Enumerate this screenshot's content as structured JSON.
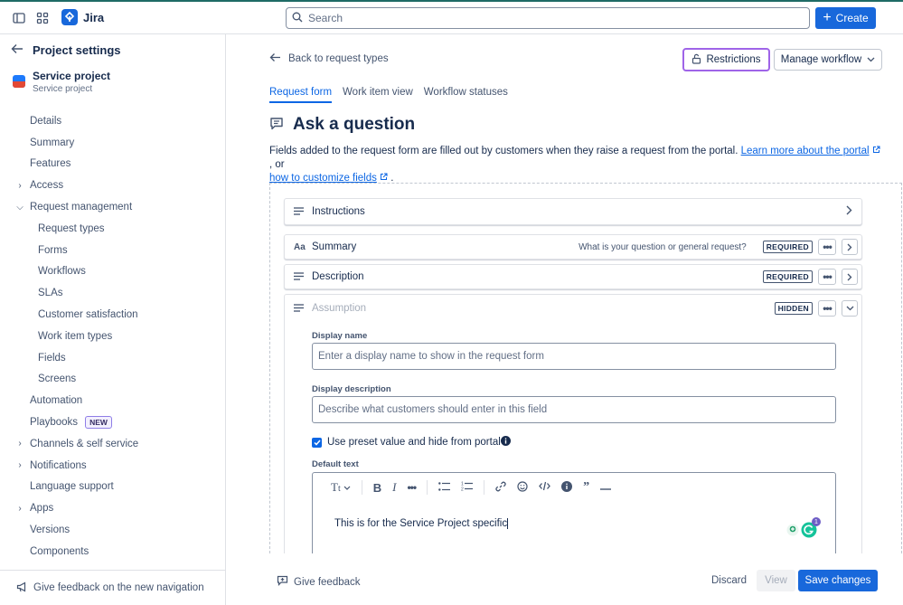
{
  "topbar": {
    "app_name": "Jira",
    "search_placeholder": "Search",
    "create_label": "Create"
  },
  "sidebar": {
    "title": "Project settings",
    "project_name": "Service project",
    "project_type": "Service project",
    "items": [
      {
        "label": "Details"
      },
      {
        "label": "Summary"
      },
      {
        "label": "Features"
      },
      {
        "label": "Access"
      },
      {
        "label": "Request management"
      },
      {
        "label": "Request types"
      },
      {
        "label": "Forms"
      },
      {
        "label": "Workflows"
      },
      {
        "label": "SLAs"
      },
      {
        "label": "Customer satisfaction"
      },
      {
        "label": "Work item types"
      },
      {
        "label": "Fields"
      },
      {
        "label": "Screens"
      },
      {
        "label": "Automation"
      },
      {
        "label": "Playbooks",
        "badge": "NEW"
      },
      {
        "label": "Channels & self service"
      },
      {
        "label": "Notifications"
      },
      {
        "label": "Language support"
      },
      {
        "label": "Apps"
      },
      {
        "label": "Versions"
      },
      {
        "label": "Components"
      }
    ],
    "feedback_label": "Give feedback on the new navigation"
  },
  "main": {
    "back_label": "Back to request types",
    "restrictions_label": "Restrictions",
    "manage_workflow_label": "Manage workflow",
    "tabs": [
      {
        "label": "Request form",
        "active": true
      },
      {
        "label": "Work item view",
        "active": false
      },
      {
        "label": "Workflow statuses",
        "active": false
      }
    ],
    "title": "Ask a question",
    "description_text": "Fields added to the request form are filled out by customers when they raise a request from the portal.",
    "learn_more_link": "Learn more about the portal",
    "or_text": ", or",
    "customize_link": "how to customize fields",
    "period": ".",
    "fields": {
      "instructions": {
        "label": "Instructions"
      },
      "summary": {
        "label": "Summary",
        "hint": "What is your question or general request?",
        "tag": "REQUIRED"
      },
      "description": {
        "label": "Description",
        "tag": "REQUIRED"
      },
      "assumption": {
        "label": "Assumption",
        "tag": "HIDDEN"
      }
    },
    "expanded": {
      "display_name_label": "Display name",
      "display_name_placeholder": "Enter a display name to show in the request form",
      "display_description_label": "Display description",
      "display_description_placeholder": "Describe what customers should enter in this field",
      "preset_label": "Use preset value and hide from portal",
      "preset_checked": true,
      "default_text_label": "Default text",
      "default_text_value": "This is for the Service Project specific",
      "grammarly_count": "1"
    },
    "footer": {
      "give_feedback_label": "Give feedback",
      "discard_label": "Discard",
      "view_label": "View",
      "save_label": "Save changes"
    }
  },
  "colors": {
    "brand_blue": "#1868db",
    "link_blue": "#0c66e4",
    "restrictions_highlight": "#9f64e8",
    "top_accent": "#1f6b66"
  }
}
